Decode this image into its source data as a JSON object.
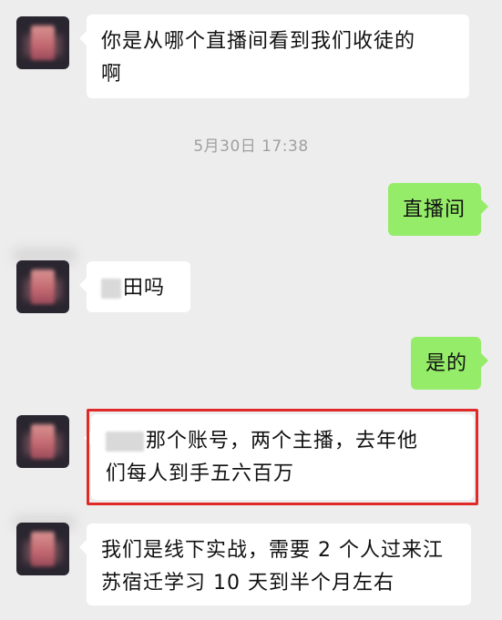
{
  "messages": [
    {
      "from": "contact",
      "text_line1": "你是从哪个直播间看到我们收徒的",
      "text_line2": "啊"
    },
    {
      "from": "timestamp",
      "text": "5月30日 17:38"
    },
    {
      "from": "me",
      "text": "直播间"
    },
    {
      "from": "contact",
      "text_visible": "田吗"
    },
    {
      "from": "me",
      "text": "是的"
    },
    {
      "from": "contact",
      "text_line1_visible": "那个账号，两个主播，去年他",
      "text_line2": "们每人到手五六百万",
      "highlighted": true
    },
    {
      "from": "contact",
      "text_line1": "我们是线下实战，需要 2 个人过来江",
      "text_line2": "苏宿迁学习 10 天到半个月左右"
    }
  ],
  "colors": {
    "background": "#ededed",
    "incoming_bubble": "#ffffff",
    "outgoing_bubble": "#95ec69",
    "highlight_border": "#e02a2a",
    "timestamp_text": "#a0a0a0"
  }
}
